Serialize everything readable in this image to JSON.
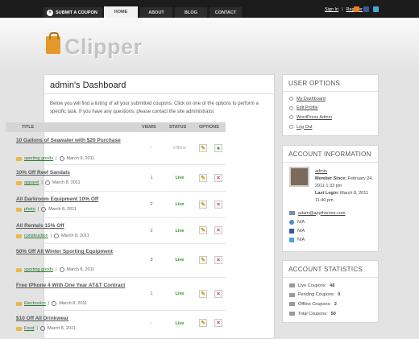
{
  "topnav": {
    "submit_label": "SUBMIT A COUPON",
    "home": "HOME",
    "about": "ABOUT",
    "blog": "BLOG",
    "contact": "CONTACT",
    "sign_in": "Sign In",
    "divider": "|",
    "register": "Register"
  },
  "brand": {
    "name": "Clipper"
  },
  "dashboard": {
    "title": "admin's Dashboard",
    "intro": "Below you will find a listing of all your submitted coupons. Click on one of the options to perform a specific task. If you have any questions, please contact the site administrator.",
    "columns": {
      "title": "TITLE",
      "views": "VIEWS",
      "status": "STATUS",
      "options": "OPTIONS"
    },
    "rows": [
      {
        "title": "10 Gallons of Seawater with $20 Purchase",
        "category": "sporting goods",
        "date": "March 9, 2011",
        "views": "-",
        "status": "Offline"
      },
      {
        "title": "10% Off Reef Sandals",
        "category": "apparel",
        "date": "March 8, 2011",
        "views": "1",
        "status": "Live"
      },
      {
        "title": "All Darkroom Equipment 10% Off",
        "category": "photo",
        "date": "March 8, 2011",
        "views": "2",
        "status": "Live"
      },
      {
        "title": "All Rentals 15% Off",
        "category": "construction",
        "date": "March 8, 2011",
        "views": "2",
        "status": "Live"
      },
      {
        "title": "50% Off All Winter Sporting Equipment",
        "category": "sporting goods",
        "date": "March 8, 2011",
        "views": "3",
        "status": "Live"
      },
      {
        "title": "Free iPhone 4 With One Year AT&T Contract",
        "category": "Electronics",
        "date": "March 8, 2011",
        "views": "1",
        "status": "Live"
      },
      {
        "title": "$10 Off All Drinkwear",
        "category": "Food",
        "date": "March 8, 2011",
        "views": "-",
        "status": "Live"
      }
    ]
  },
  "user_options": {
    "title": "USER OPTIONS",
    "items": [
      "My Dashboard",
      "Edit Profile",
      "WordPress Admin",
      "Log Out"
    ]
  },
  "account_info": {
    "title": "ACCOUNT INFORMATION",
    "username": "admin",
    "member_since_label": "Member Since:",
    "member_since": "February 24, 2011 1:33 pm",
    "last_login_label": "Last Login:",
    "last_login": "March 8, 2011 11:40 pm",
    "email": "adam@appthemes.com",
    "website": "N/A",
    "facebook": "N/A",
    "twitter": "N/A"
  },
  "account_stats": {
    "title": "ACCOUNT STATISTICS",
    "live_label": "Live Coupons:",
    "live": "48",
    "pending_label": "Pending Coupons:",
    "pending": "0",
    "offline_label": "Offline Coupons:",
    "offline": "2",
    "total_label": "Total Coupons:",
    "total": "50"
  },
  "colors": {
    "live": "#2e9e1f",
    "offline": "#aaaaaa",
    "accent": "#e49a2a"
  }
}
